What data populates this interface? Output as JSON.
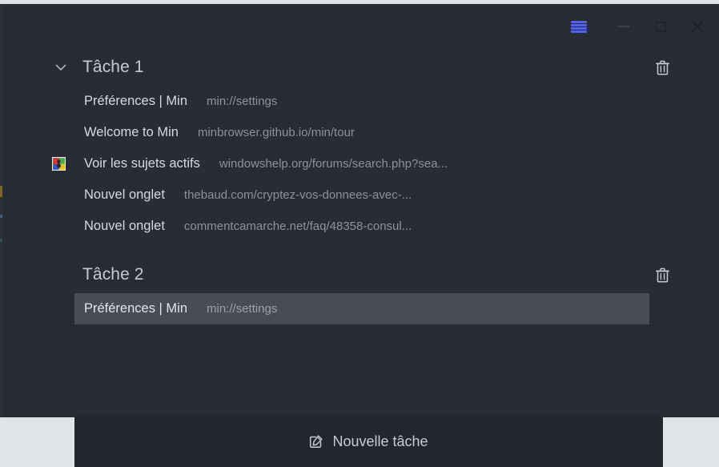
{
  "window": {
    "titlebar": {
      "menu_icon": "hamburger-menu-icon",
      "minimize_label": "Réduire",
      "maximize_label": "Agrandir",
      "close_label": "Fermer"
    }
  },
  "tasks": [
    {
      "name": "Tâche 1",
      "expanded": true,
      "chevron_icon": "chevron-down-icon",
      "delete_icon": "trash-icon",
      "tabs": [
        {
          "title": "Préférences | Min",
          "url": "min://settings",
          "favicon": null,
          "selected": false
        },
        {
          "title": "Welcome to Min",
          "url": "minbrowser.github.io/min/tour",
          "favicon": null,
          "selected": false
        },
        {
          "title": "Voir les sujets actifs",
          "url": "windowshelp.org/forums/search.php?sea...",
          "favicon": "windows-logo-favicon",
          "selected": false
        },
        {
          "title": "Nouvel onglet",
          "url": "thebaud.com/cryptez-vos-donnees-avec-...",
          "favicon": null,
          "selected": false
        },
        {
          "title": "Nouvel onglet",
          "url": "commentcamarche.net/faq/48358-consul...",
          "favicon": null,
          "selected": false
        }
      ]
    },
    {
      "name": "Tâche 2",
      "expanded": true,
      "chevron_icon": null,
      "delete_icon": "trash-icon",
      "tabs": [
        {
          "title": "Préférences | Min",
          "url": "min://settings",
          "favicon": null,
          "selected": true
        }
      ]
    }
  ],
  "new_task": {
    "label": "Nouvelle tâche",
    "icon": "edit-square-icon"
  },
  "colors": {
    "window_background": "#282c35",
    "selected_row": "#474c57",
    "new_task_panel": "#22262e",
    "accent_menu": "#5165d8",
    "title_text": "#c6cad3",
    "tab_title_text": "#d5d9e0",
    "tab_url_text": "#8b919d"
  }
}
